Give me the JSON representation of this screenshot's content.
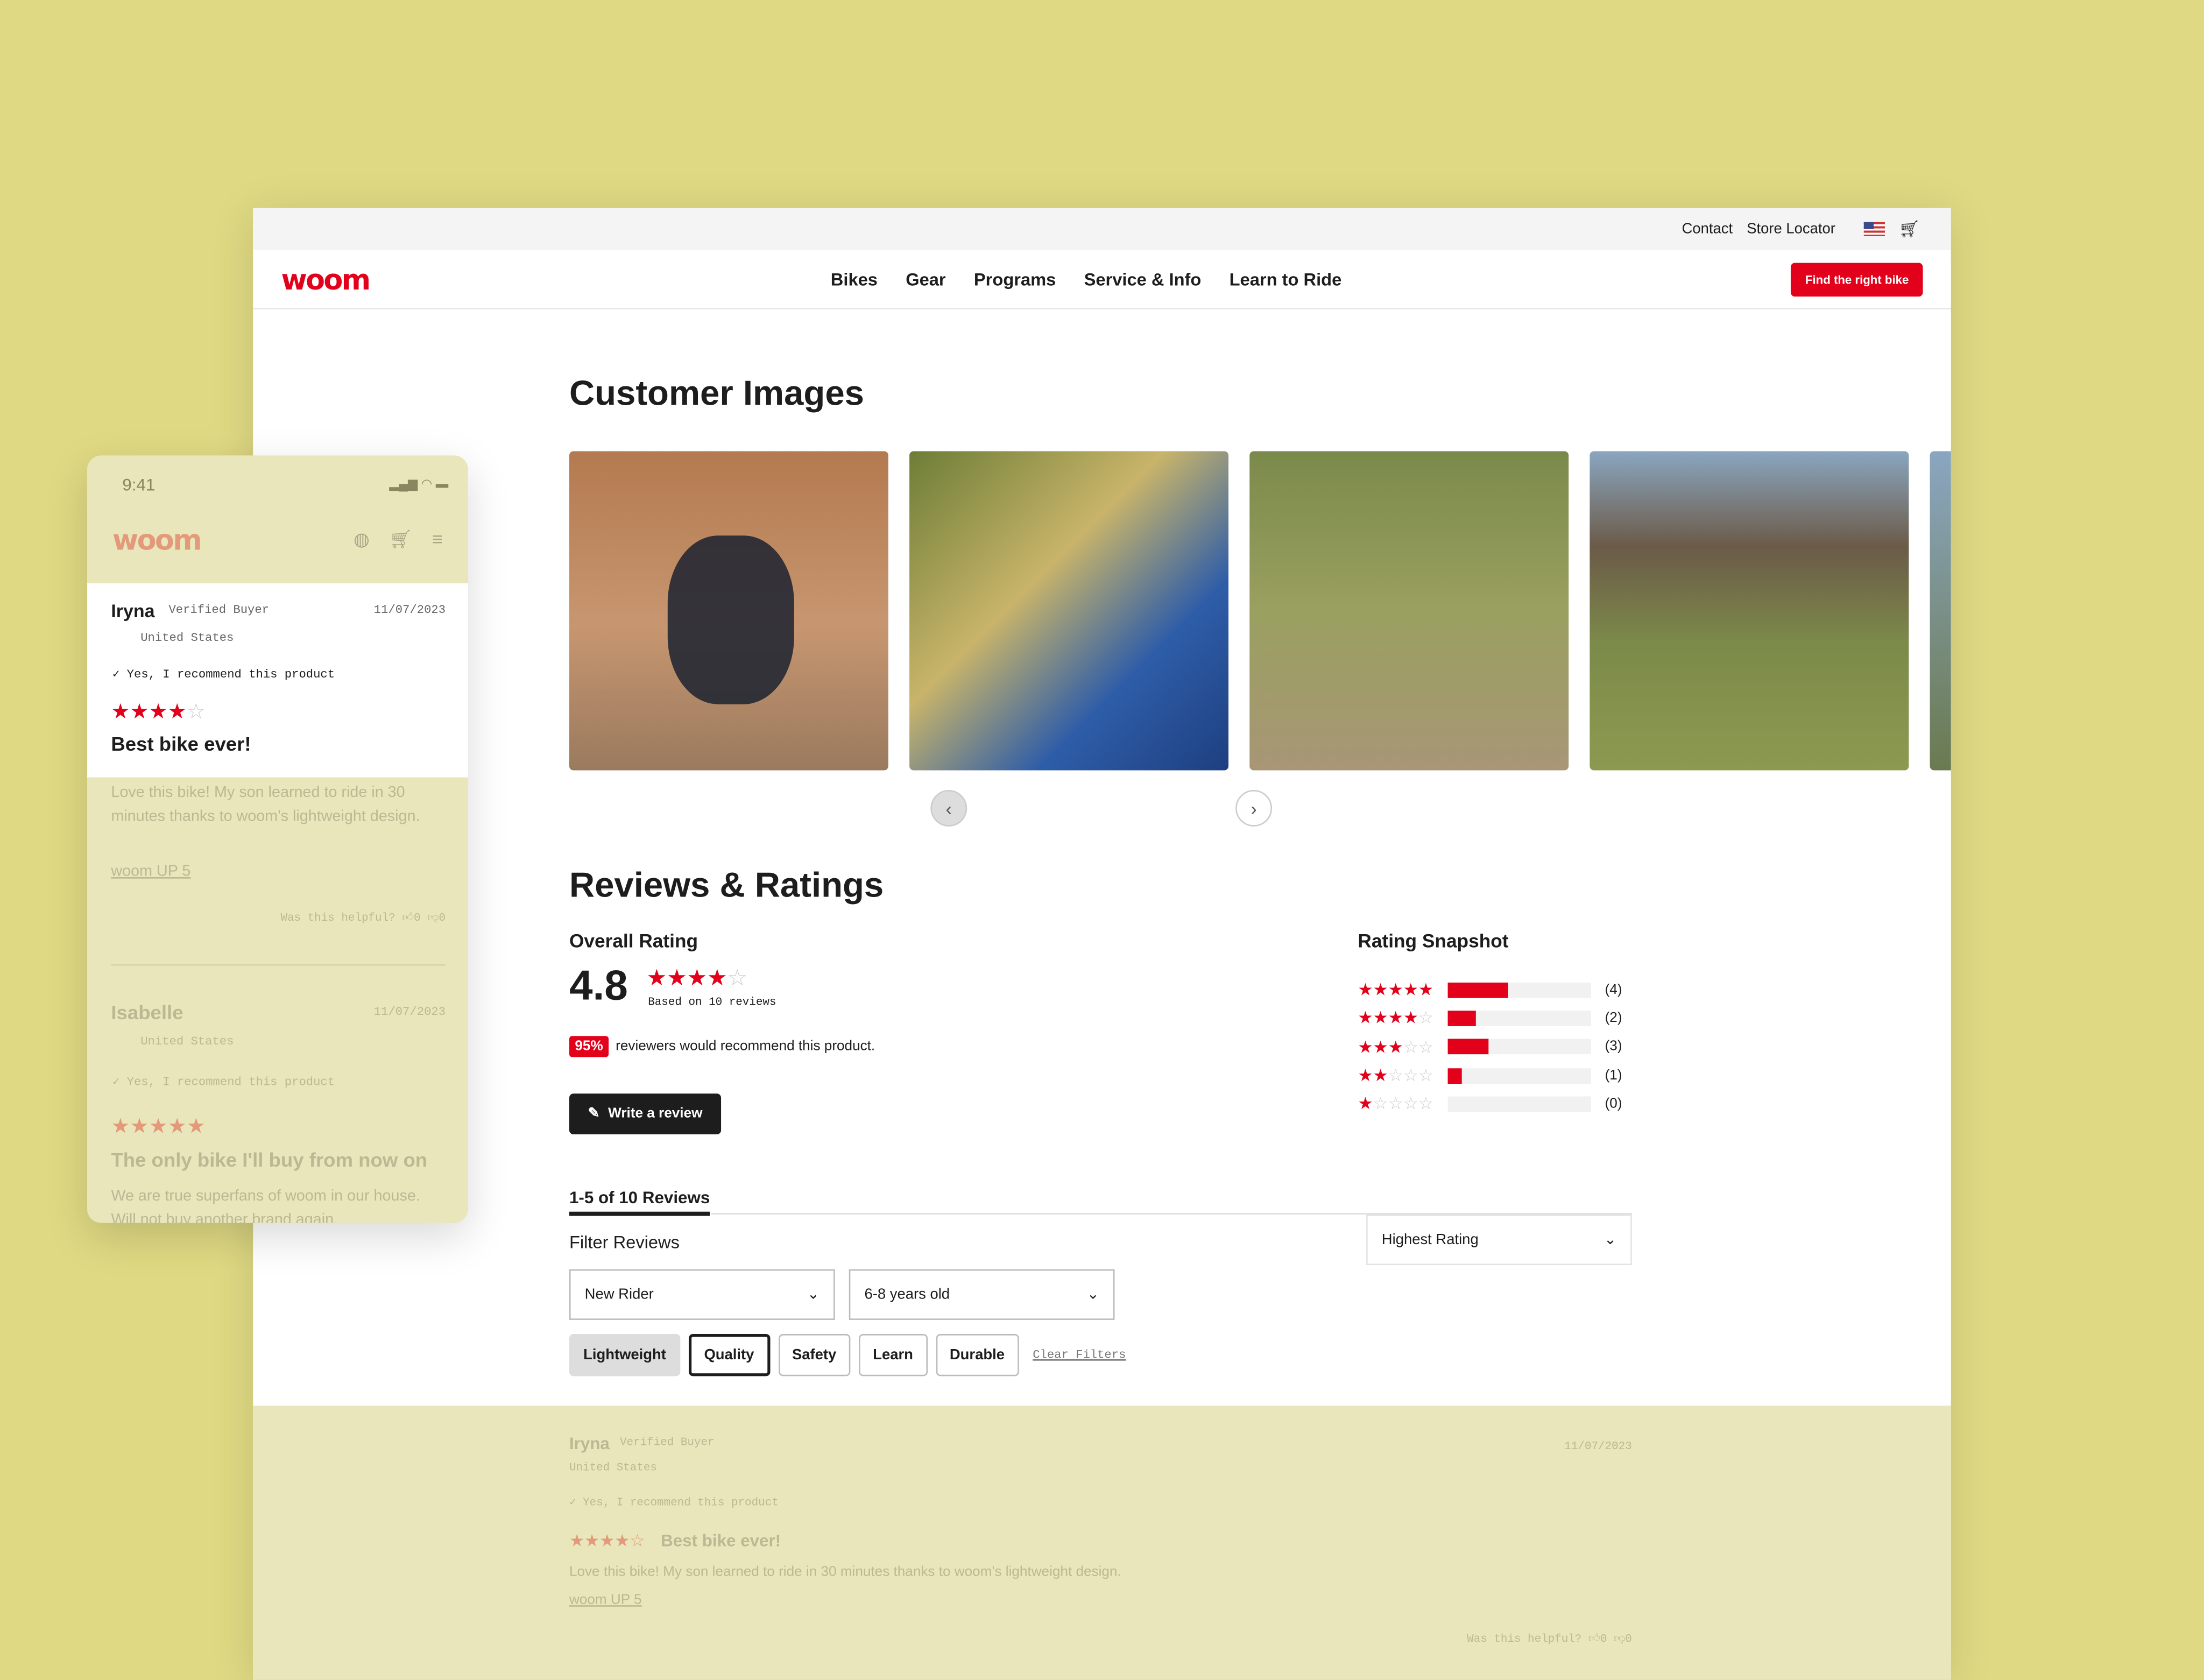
{
  "util": {
    "contact": "Contact",
    "store_locator": "Store Locator"
  },
  "nav": {
    "logo": "woom",
    "items": [
      "Bikes",
      "Gear",
      "Programs",
      "Service & Info",
      "Learn to Ride"
    ],
    "cta": "Find the right bike"
  },
  "customer_images": {
    "title": "Customer Images"
  },
  "reviews": {
    "title": "Reviews & Ratings",
    "overall_label": "Overall Rating",
    "score": "4.8",
    "score_stars": 4,
    "based_on": "Based on 10 reviews",
    "recommend_pct": "95%",
    "recommend_text": "reviewers would recommend this product.",
    "write_review": "Write a review",
    "snapshot_label": "Rating Snapshot",
    "snapshot": [
      {
        "stars": 5,
        "count": "(4)",
        "fill": 0.42
      },
      {
        "stars": 4,
        "count": "(2)",
        "fill": 0.2
      },
      {
        "stars": 3,
        "count": "(3)",
        "fill": 0.29
      },
      {
        "stars": 2,
        "count": "(1)",
        "fill": 0.1
      },
      {
        "stars": 1,
        "count": "(0)",
        "fill": 0
      }
    ],
    "tab": "1-5 of 10 Reviews",
    "filter_label": "Filter Reviews",
    "sort": "Highest Rating",
    "filter_rider": "New Rider",
    "filter_age": "6-8 years old",
    "chips": [
      "Lightweight",
      "Quality",
      "Safety",
      "Learn",
      "Durable"
    ],
    "clear": "Clear Filters"
  },
  "review_list": [
    {
      "name": "Iryna",
      "badge": "Verified Buyer",
      "country": "United States",
      "recommend": "Yes, I recommend this product",
      "stars": 4,
      "title": "Best bike ever!",
      "body": "Love this bike! My son learned to ride in 30 minutes thanks to woom's lightweight design.",
      "product": "woom UP 5",
      "date": "11/07/2023",
      "helpful": "Was this helpful?",
      "up": "0",
      "down": "0"
    },
    {
      "name": "Isabelle",
      "country": "United States",
      "recommend": "Yes, I recommend this product",
      "stars": 5,
      "title": "The only bike I'll buy from now on",
      "body": "We are true superfans of woom in our house. Will not buy another brand again.",
      "date": "11/07/2023"
    }
  ],
  "mobile": {
    "time": "9:41",
    "logo": "woom"
  },
  "colors": {
    "brand": "#e3001b",
    "background": "#dfd983"
  }
}
